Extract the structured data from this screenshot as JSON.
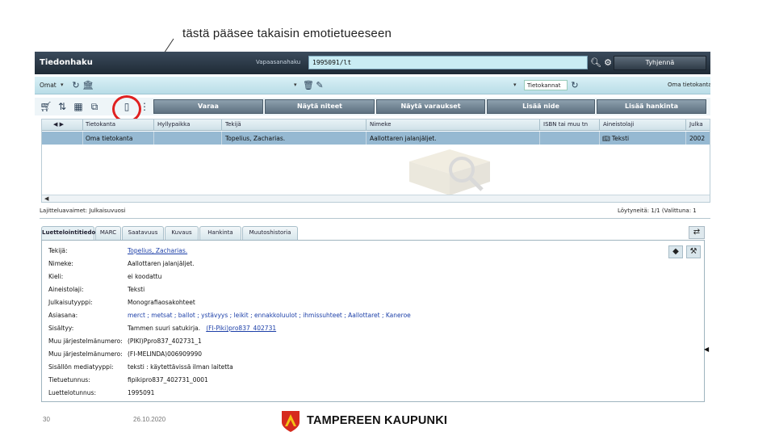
{
  "annotation": {
    "text": "tästä pääsee takaisin emotietueeseen"
  },
  "app": {
    "title": "Tiedonhaku",
    "quick_search": {
      "label": "Vapaasanahaku",
      "value": "1995091/lt"
    },
    "clear_button": "Tyhjennä",
    "toolbar1": {
      "own_menu": "Omat",
      "databases_label": "Tietokannat",
      "own_db": "Oma tietokanta"
    },
    "actions": [
      "Varaa",
      "Näytä niteet",
      "Näytä varaukset",
      "Lisää nide",
      "Lisää hankinta"
    ],
    "grid": {
      "columns": [
        "Tietokanta",
        "Hyllypaikka",
        "Tekijä",
        "Nimeke",
        "ISBN tai muu tn",
        "Aineistolaji",
        "Julka"
      ],
      "rows": [
        {
          "tietokanta": "Oma tietokanta",
          "hyllypaikka": "",
          "tekija": "Topelius, Zacharias.",
          "nimeke": "Aallottaren jalanjäljet.",
          "isbn": "",
          "aineistolaji": "Teksti",
          "julka": "2002"
        }
      ]
    },
    "status": {
      "sort": "Lajitteluavaimet: Julkaisuvuosi",
      "found": "Löytyneitä: 1/1 (Valittuna: 1"
    },
    "tabs": [
      "Luettelointitiedot",
      "MARC",
      "Saatavuus",
      "Kuvaus",
      "Hankinta",
      "Muutoshistoria"
    ],
    "details": [
      {
        "label": "Tekijä:",
        "value": "Topelius, Zacharias.",
        "style": "link"
      },
      {
        "label": "Nimeke:",
        "value": "Aallottaren jalanjäljet.",
        "style": "plain"
      },
      {
        "label": "Kieli:",
        "value": "ei koodattu",
        "style": "plain"
      },
      {
        "label": "Aineistolaji:",
        "value": "Teksti",
        "style": "plain"
      },
      {
        "label": "Julkaisutyyppi:",
        "value": "Monografiaosakohteet",
        "style": "plain"
      },
      {
        "label": "Asiasana:",
        "value": "merct ; metsat ; ballot ; ystävyys ; leikit ; ennakkoluulot ; ihmissuhteet ; Aallottaret ; Kaneroe",
        "style": "blue"
      },
      {
        "label": "Sisältyy:",
        "value": "Tammen suuri satukirja.",
        "style": "plain",
        "extra": "(FI-Piki)pro837_402731"
      },
      {
        "label": "Muu järjestelmänumero:",
        "value": "(PIKI)Ppro837_402731_1",
        "style": "plain"
      },
      {
        "label": "Muu järjestelmänumero:",
        "value": "(FI-MELINDA)006909990",
        "style": "plain"
      },
      {
        "label": "Sisällön mediatyyppi:",
        "value": "teksti : käytettävissä ilman laitetta",
        "style": "plain"
      },
      {
        "label": "Tietuetunnus:",
        "value": "fipikipro837_402731_0001",
        "style": "plain"
      },
      {
        "label": "Luettelotunnus:",
        "value": "1995091",
        "style": "plain"
      }
    ]
  },
  "footer": {
    "page": "30",
    "date": "26.10.2020",
    "org": "TAMPEREEN KAUPUNKI"
  },
  "colors": {
    "accent": "#96b9d2",
    "circle": "#e02020",
    "logo_red": "#d62a1e",
    "logo_yellow": "#f2c316"
  }
}
